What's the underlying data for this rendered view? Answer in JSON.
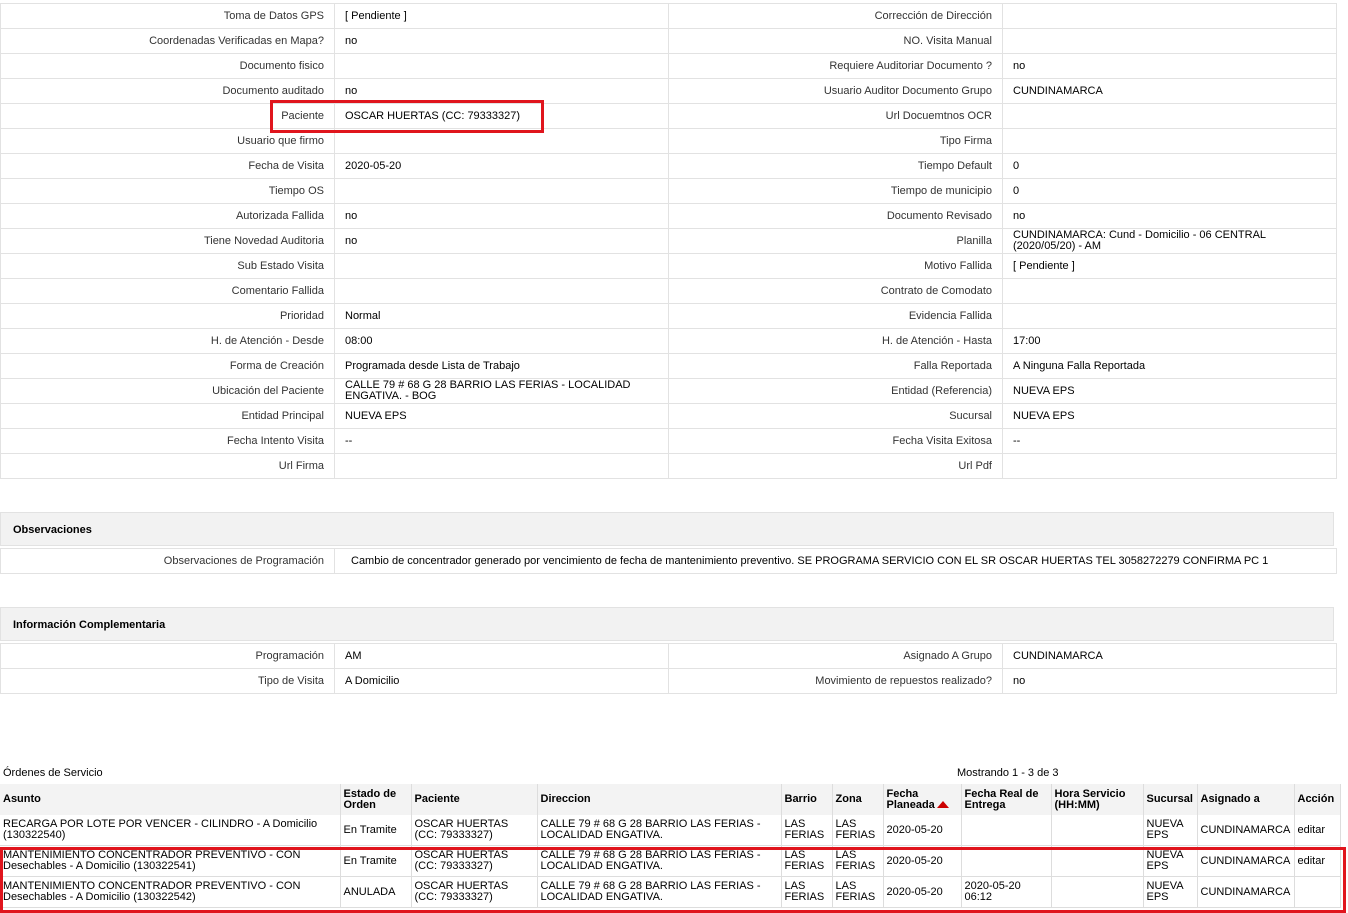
{
  "details": [
    [
      "Toma de Datos GPS",
      "[ Pendiente ]",
      "Corrección de Dirección",
      ""
    ],
    [
      "Coordenadas Verificadas en Mapa?",
      " no",
      "NO. Visita Manual",
      ""
    ],
    [
      "Documento fisico",
      "",
      "Requiere Auditoriar Documento ?",
      " no"
    ],
    [
      "Documento auditado",
      " no",
      "Usuario Auditor Documento Grupo",
      "CUNDINAMARCA"
    ],
    [
      "Paciente",
      "OSCAR HUERTAS (CC: 79333327)",
      "Url Docuemtnos OCR",
      ""
    ],
    [
      "Usuario que firmo",
      "",
      "Tipo Firma",
      ""
    ],
    [
      "Fecha de Visita",
      " 2020-05-20",
      "Tiempo Default",
      "0"
    ],
    [
      "Tiempo OS",
      "",
      "Tiempo de municipio",
      "0"
    ],
    [
      "Autorizada Fallida",
      " no",
      "Documento Revisado",
      " no"
    ],
    [
      "Tiene Novedad Auditoria",
      " no",
      "Planilla",
      "CUNDINAMARCA: Cund - Domicilio - 06 CENTRAL (2020/05/20) - AM"
    ],
    [
      "Sub Estado Visita",
      "",
      "Motivo Fallida",
      "[ Pendiente ]"
    ],
    [
      "Comentario Fallida",
      "",
      "Contrato de Comodato",
      ""
    ],
    [
      "Prioridad",
      "Normal",
      "Evidencia Fallida",
      ""
    ],
    [
      "H. de Atención - Desde",
      "08:00",
      "H. de Atención - Hasta",
      "17:00"
    ],
    [
      "Forma de Creación",
      "Programada desde Lista de Trabajo",
      "Falla Reportada",
      "A Ninguna Falla Reportada"
    ],
    [
      "Ubicación del Paciente",
      "CALLE 79 # 68 G 28 BARRIO LAS FERIAS - LOCALIDAD ENGATIVA. - BOG",
      "Entidad (Referencia)",
      "NUEVA EPS"
    ],
    [
      "Entidad Principal",
      "NUEVA EPS",
      "Sucursal",
      "NUEVA EPS"
    ],
    [
      "Fecha Intento Visita",
      " --",
      "Fecha Visita Exitosa",
      " --"
    ],
    [
      "Url Firma",
      "",
      "Url Pdf",
      ""
    ]
  ],
  "observaciones": {
    "title": "Observaciones",
    "label": "Observaciones de Programación",
    "value": "Cambio de concentrador generado por vencimiento de fecha de mantenimiento preventivo. SE PROGRAMA SERVICIO CON EL SR OSCAR HUERTAS TEL 3058272279 CONFIRMA PC 1"
  },
  "complementaria": {
    "title": "Información Complementaria",
    "rows": [
      [
        "Programación",
        "AM",
        "Asignado A Grupo",
        "CUNDINAMARCA"
      ],
      [
        "Tipo de Visita",
        "A Domicilio",
        "Movimiento de repuestos realizado?",
        " no"
      ]
    ]
  },
  "orders": {
    "title": "Órdenes de Servicio",
    "showing": "Mostrando 1 - 3 de 3",
    "headers": [
      "Asunto",
      "Estado de Orden",
      "Paciente",
      "Direccion",
      "Barrio",
      "Zona",
      "Fecha Planeada",
      "Fecha Real de Entrega",
      "Hora Servicio (HH:MM)",
      "Sucursal",
      "Asignado a",
      "Acción"
    ],
    "rows": [
      [
        "RECARGA POR LOTE POR VENCER - CILINDRO - A Domicilio (130322540)",
        "En Tramite",
        "OSCAR HUERTAS (CC: 79333327)",
        "CALLE 79 # 68 G 28 BARRIO LAS FERIAS - LOCALIDAD ENGATIVA.",
        "LAS FERIAS",
        "LAS FERIAS",
        "2020-05-20",
        "",
        "",
        "NUEVA EPS",
        "CUNDINAMARCA",
        "editar"
      ],
      [
        "MANTENIMIENTO CONCENTRADOR PREVENTIVO - CON Desechables - A Domicilio (130322541)",
        "En Tramite",
        "OSCAR HUERTAS (CC: 79333327)",
        "CALLE 79 # 68 G 28 BARRIO LAS FERIAS - LOCALIDAD ENGATIVA.",
        "LAS FERIAS",
        "LAS FERIAS",
        "2020-05-20",
        "",
        "",
        "NUEVA EPS",
        "CUNDINAMARCA",
        "editar"
      ],
      [
        "MANTENIMIENTO CONCENTRADOR PREVENTIVO - CON Desechables - A Domicilio (130322542)",
        "ANULADA",
        "OSCAR HUERTAS (CC: 79333327)",
        "CALLE 79 # 68 G 28 BARRIO LAS FERIAS - LOCALIDAD ENGATIVA.",
        "LAS FERIAS",
        "LAS FERIAS",
        "2020-05-20",
        "2020-05-20 06:12",
        "",
        "NUEVA EPS",
        "CUNDINAMARCA",
        ""
      ]
    ]
  },
  "colors": {
    "highlight": "#e0151d",
    "sort_arrow": "#cc0000",
    "header_bg": "#f3f3f3"
  }
}
